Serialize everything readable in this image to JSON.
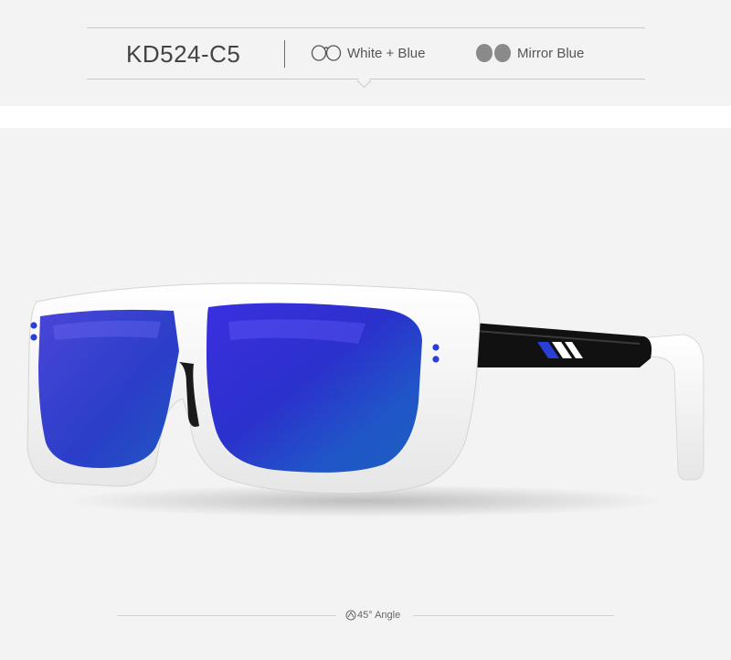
{
  "header": {
    "model_code": "KD524-C5",
    "frame_color": "White + Blue",
    "lens_color": "Mirror Blue"
  },
  "footer": {
    "angle_label": "45° Angle"
  },
  "colors": {
    "frame": "#f7f7f7",
    "lens_blue": "#2c2fd0",
    "accent_blue": "#2a3fd8",
    "temple_black": "#111111"
  },
  "icons": {
    "frame_icon": "glasses-outline-icon",
    "lens_icon": "lens-pair-icon",
    "angle_icon": "angle-badge-icon"
  }
}
